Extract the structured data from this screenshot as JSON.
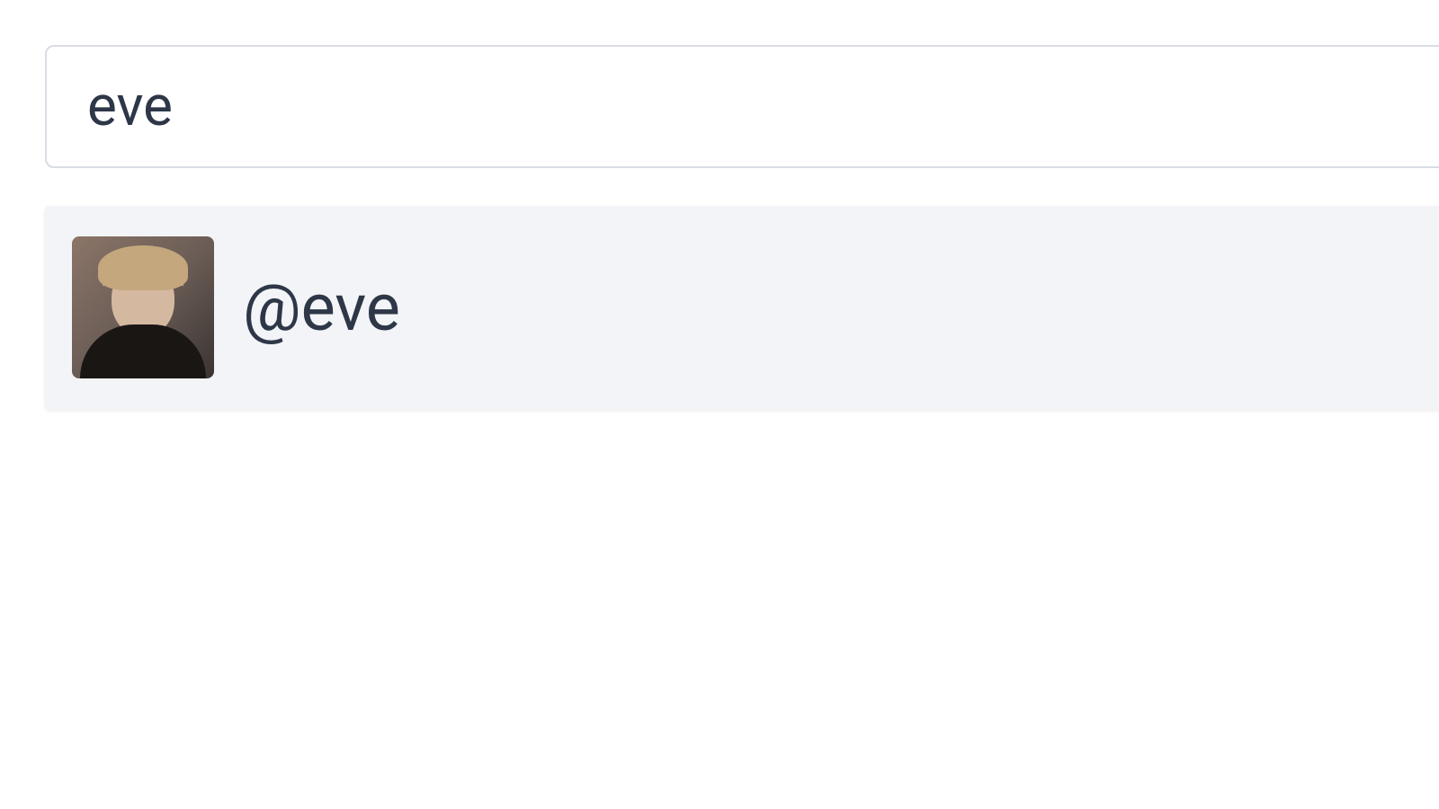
{
  "search": {
    "value": "eve"
  },
  "results": [
    {
      "handle": "@eve"
    }
  ]
}
